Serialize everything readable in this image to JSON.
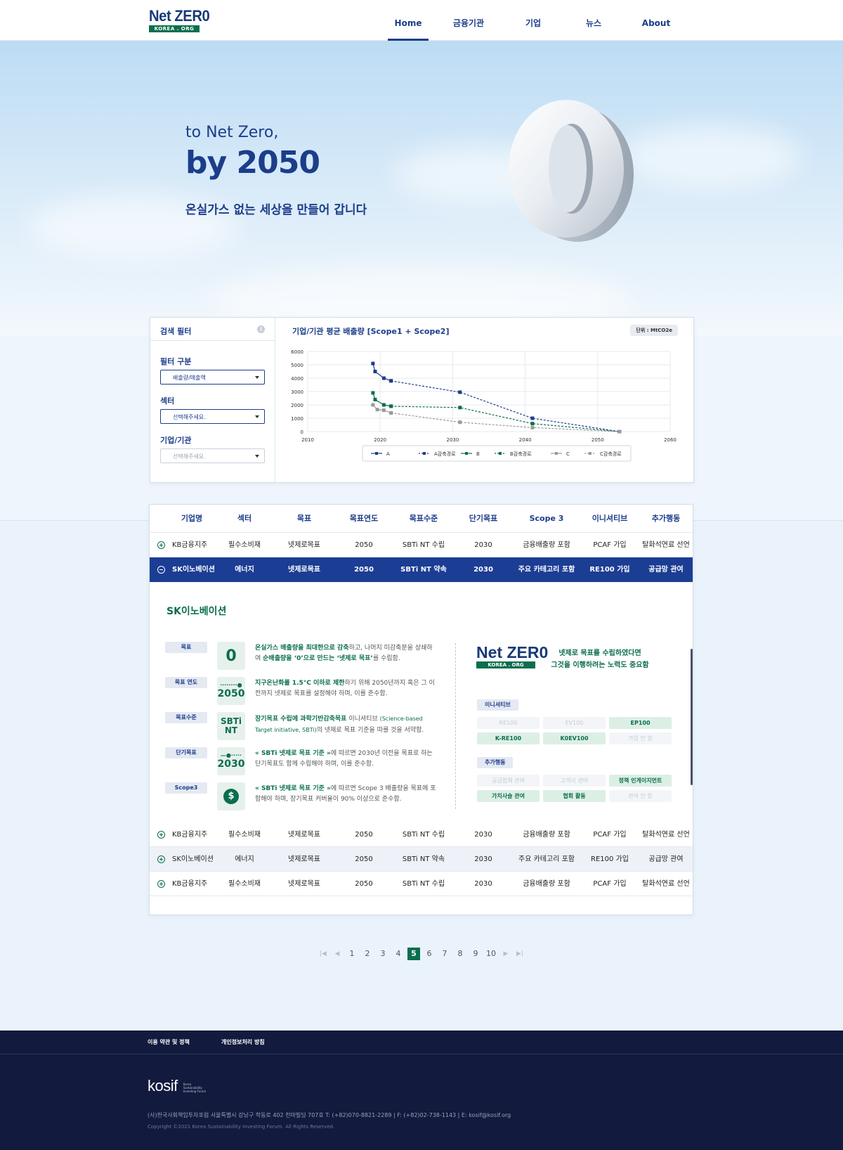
{
  "header": {
    "logo_top": "Net ZER0",
    "logo_bottom": "KOREA . ORG",
    "nav": [
      "Home",
      "금융기관",
      "기업",
      "뉴스",
      "About"
    ],
    "active": "Home"
  },
  "hero": {
    "sub": "to Net Zero,",
    "title": "by 2050",
    "desc": "온실가스 없는 세상을 만들어 갑니다"
  },
  "filter": {
    "title": "검색 필터",
    "filter_label": "필터 구분",
    "filter_value": "배출량/매출액",
    "sector_label": "섹터",
    "sector_value": "선택해주세요.",
    "company_label": "기업/기관",
    "company_value": "선택해주세요."
  },
  "chart": {
    "title": "기업/기관 평균 배출량 [Scope1 + Scope2]",
    "unit": "단위 : MtCO2e"
  },
  "chart_data": {
    "type": "line",
    "title": "기업/기관 평균 배출량 [Scope1 + Scope2]",
    "xlabel": "",
    "ylabel": "",
    "xlim": [
      2010,
      2060
    ],
    "ylim": [
      0,
      6000
    ],
    "x_ticks": [
      2010,
      2020,
      2030,
      2040,
      2050,
      2060
    ],
    "y_ticks": [
      0,
      1000,
      2000,
      3000,
      4000,
      5000,
      6000
    ],
    "grid": true,
    "legend_position": "bottom",
    "series": [
      {
        "name": "A",
        "color": "#1c3d8a",
        "style": "solid",
        "x": [
          2019,
          2019.3,
          2020.5,
          2021.5
        ],
        "y": [
          5100,
          4500,
          4000,
          3800
        ]
      },
      {
        "name": "A감축경로",
        "color": "#1c3d8a",
        "style": "dashed",
        "x": [
          2021.5,
          2031,
          2041,
          2053
        ],
        "y": [
          3800,
          2950,
          1000,
          0
        ]
      },
      {
        "name": "B",
        "color": "#0b6e4f",
        "style": "solid",
        "x": [
          2019,
          2019.3,
          2020.5,
          2021.5
        ],
        "y": [
          2900,
          2400,
          2000,
          1900
        ]
      },
      {
        "name": "B감축경로",
        "color": "#0b6e4f",
        "style": "dashed",
        "x": [
          2021.5,
          2031,
          2041,
          2053
        ],
        "y": [
          1900,
          1800,
          600,
          0
        ]
      },
      {
        "name": "C",
        "color": "#9a9a9a",
        "style": "solid",
        "x": [
          2019,
          2019.6,
          2020.5,
          2021.5
        ],
        "y": [
          2000,
          1650,
          1600,
          1400
        ]
      },
      {
        "name": "C감축경로",
        "color": "#9a9a9a",
        "style": "dashed",
        "x": [
          2021.5,
          2031,
          2041,
          2053
        ],
        "y": [
          1400,
          700,
          300,
          0
        ]
      }
    ]
  },
  "table": {
    "headers": [
      "기업명",
      "섹터",
      "목표",
      "목표연도",
      "목표수준",
      "단기목표",
      "Scope 3",
      "이니셔티브",
      "추가행동"
    ],
    "rows": [
      [
        "KB금융지주",
        "필수소비재",
        "넷제로목표",
        "2050",
        "SBTi NT 수립",
        "2030",
        "금융배출량 포함",
        "PCAF 가입",
        "탈화석연료 선언"
      ],
      [
        "SK이노베이션",
        "에너지",
        "넷제로목표",
        "2050",
        "SBTi NT 약속",
        "2030",
        "주요 카테고리 포함",
        "RE100 가입",
        "공급망 관여"
      ],
      [
        "KB금융지주",
        "필수소비재",
        "넷제로목표",
        "2050",
        "SBTi NT 수립",
        "2030",
        "금융배출량 포함",
        "PCAF 가입",
        "탈화석연료 선언"
      ],
      [
        "SK이노베이션",
        "에너지",
        "넷제로목표",
        "2050",
        "SBTi NT 약속",
        "2030",
        "주요 카테고리 포함",
        "RE100 가입",
        "공급망 관여"
      ],
      [
        "KB금융지주",
        "필수소비재",
        "넷제로목표",
        "2050",
        "SBTi NT 수립",
        "2030",
        "금융배출량 포함",
        "PCAF 가입",
        "탈화석연료 선언"
      ]
    ]
  },
  "detail": {
    "title": "SK이노베이션",
    "items": [
      {
        "tag": "목표",
        "icon": "0",
        "hl1": "온실가스 배출량을 최대한으로 감축",
        "t1": "하고, 나머지 미감축분을 상쇄하여 ",
        "hl2": "순배출량을 ‘0’으로 만드는 ‘넷제로 목표’",
        "t2": "를 수립함."
      },
      {
        "tag": "목표 연도",
        "icon": "2050",
        "hl1": "지구온난화를 1.5°C 이하로 제한",
        "t1": "하기 위해 2050년까지 혹은 그 이전까지 넷제로 목표를 설정해야 하며, 이를 준수함.",
        "hl2": "",
        "t2": ""
      },
      {
        "tag": "목표수준",
        "icon": "SBTi NT",
        "hl1": "장기목표 수립에 과학기반감축목표",
        "t1": " 이니셔티브 ",
        "sm": "(Science-based Target initiative, SBTi)",
        "t2": "의 넷제로 목표 기준을 따를 것을 서약함."
      },
      {
        "tag": "단기목표",
        "icon": "2030",
        "hl1": "« SBTi 넷제로 목표 기준 »",
        "t1": "에 따르면 2030년 이전을 목표로 하는 단기목표도 함께 수립해야 하며, 이를 준수함.",
        "hl2": "",
        "t2": ""
      },
      {
        "tag": "Scope3",
        "icon": "$",
        "hl1": "« SBTi 넷제로 목표 기준 »",
        "t1": "에 따르면 Scope 3 배출량을 목표에 포함해야 하며, 장기목표 커버율이 90% 이상으로 준수함.",
        "hl2": "",
        "t2": ""
      }
    ],
    "slogan_line1": "넷제로 목표를 수립하였다면",
    "slogan_line2": "그것을 이행하려는 노력도 중요함",
    "initiative_label": "이니셔티브",
    "initiatives": [
      {
        "label": "RE100",
        "on": false
      },
      {
        "label": "EV100",
        "on": false
      },
      {
        "label": "EP100",
        "on": true
      },
      {
        "label": "K-RE100",
        "on": true
      },
      {
        "label": "K0EV100",
        "on": true
      },
      {
        "label": "가입 안 함",
        "on": false
      }
    ],
    "actions_label": "추가행동",
    "actions": [
      {
        "label": "공급업체 관여",
        "on": false
      },
      {
        "label": "고객사 관여",
        "on": false
      },
      {
        "label": "정책 인게이지먼트",
        "on": true
      },
      {
        "label": "가치사슬 관여",
        "on": true
      },
      {
        "label": "협회 활동",
        "on": true
      },
      {
        "label": "관여 안 함",
        "on": false
      }
    ]
  },
  "pagination": {
    "pages": [
      "1",
      "2",
      "3",
      "4",
      "5",
      "6",
      "7",
      "8",
      "9",
      "10"
    ],
    "current": "5",
    "first": "|◀",
    "prev": "◀",
    "next": "▶",
    "last": "▶|"
  },
  "footer": {
    "links": [
      "이용 약관 및 정책",
      "개인정보처리 방침"
    ],
    "brand": "kosif",
    "brand_small": "Korea Sustainability Investing Forum",
    "address": "(사)한국사회책임투자포럼 서울특별시 강남구 학동로 402 천마빌딩 707호 T: (+82)070-8821-2289 | F: (+82)02-738-1143 | E: kosif@kosif.org",
    "copyright": "Copyright ©2021 Korea Sustainability Investing Forum. All Rights Reserved."
  }
}
